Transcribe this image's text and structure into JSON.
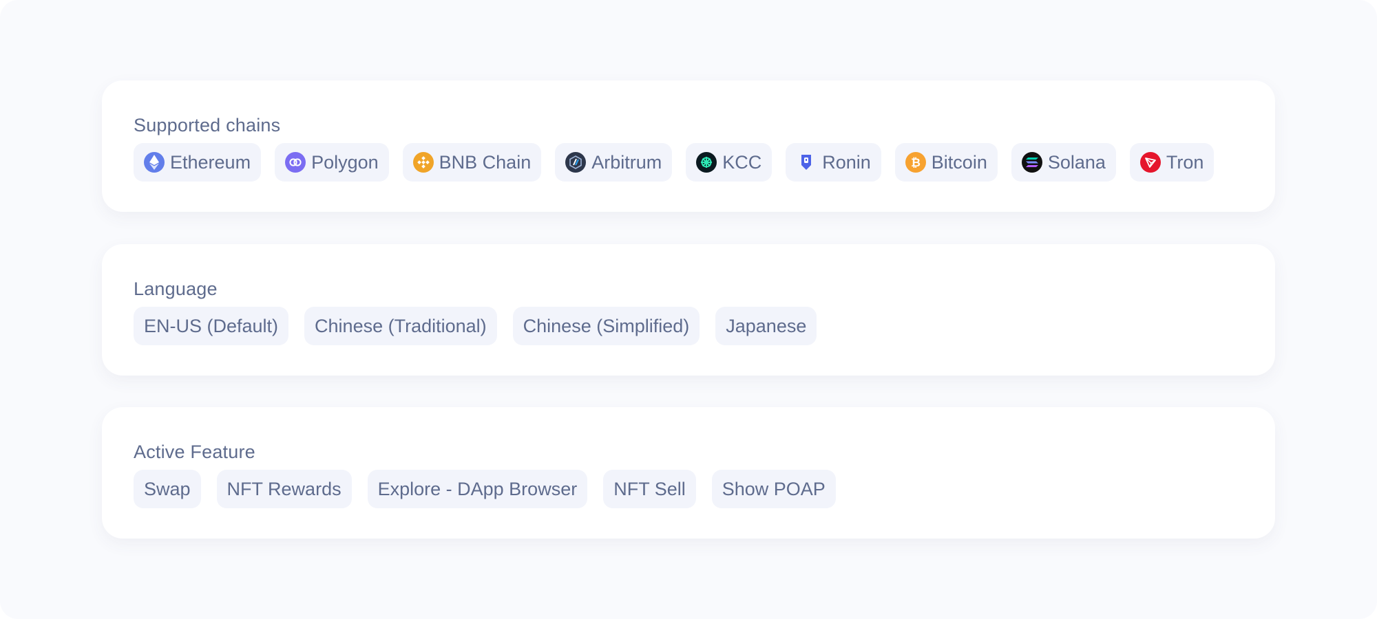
{
  "chains": {
    "title": "Supported chains",
    "items": [
      {
        "label": "Ethereum",
        "icon": "ethereum-icon",
        "color": "#627eea"
      },
      {
        "label": "Polygon",
        "icon": "polygon-icon",
        "color": "#7b6df2"
      },
      {
        "label": "BNB Chain",
        "icon": "bnb-chain-icon",
        "color": "#f0a428"
      },
      {
        "label": "Arbitrum",
        "icon": "arbitrum-icon",
        "color": "#2d374b"
      },
      {
        "label": "KCC",
        "icon": "kcc-icon",
        "color": "#0b1a20"
      },
      {
        "label": "Ronin",
        "icon": "ronin-icon",
        "color": "#4d63e8"
      },
      {
        "label": "Bitcoin",
        "icon": "bitcoin-icon",
        "color": "#f7a230"
      },
      {
        "label": "Solana",
        "icon": "solana-icon",
        "color": "#111111"
      },
      {
        "label": "Tron",
        "icon": "tron-icon",
        "color": "#e5162c"
      }
    ]
  },
  "language": {
    "title": "Language",
    "items": [
      {
        "label": "EN-US (Default)"
      },
      {
        "label": "Chinese (Traditional)"
      },
      {
        "label": "Chinese (Simplified)"
      },
      {
        "label": "Japanese"
      }
    ]
  },
  "features": {
    "title": "Active Feature",
    "items": [
      {
        "label": "Swap"
      },
      {
        "label": "NFT Rewards"
      },
      {
        "label": "Explore - DApp Browser"
      },
      {
        "label": "NFT Sell"
      },
      {
        "label": "Show POAP"
      }
    ]
  },
  "colors": {
    "page_background": "#f9fafd",
    "card_background": "#ffffff",
    "chip_background": "#f2f4fb",
    "text": "#5e6b8d"
  }
}
